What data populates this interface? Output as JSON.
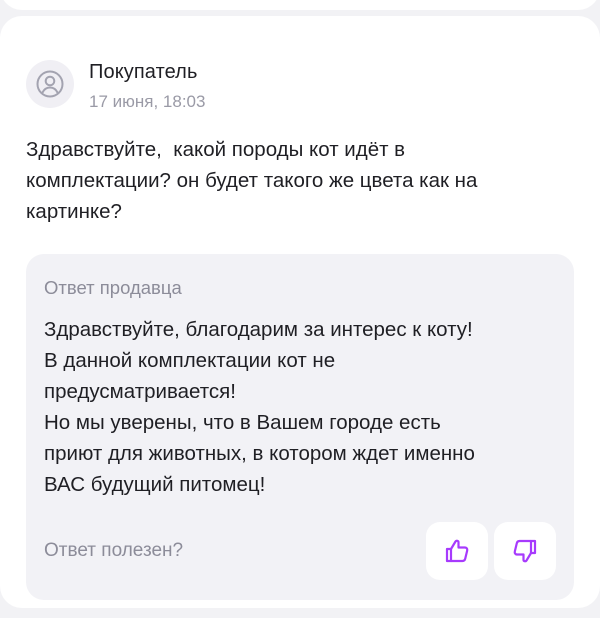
{
  "review": {
    "author": "Покупатель",
    "date": "17 июня, 18:03",
    "avatar_icon": "user-icon",
    "question": "Здравствуйте,  какой породы кот идёт в\nкомплектации? он будет такого же цвета как на\nкартинке?"
  },
  "seller_answer": {
    "title": "Ответ продавца",
    "text": "Здравствуйте, благодарим за интерес к коту!\nВ данной комплектации кот не\nпредусматривается!\nНо мы уверены, что в Вашем городе есть\nприют для животных, в котором ждет именно\nВАС будущий питомец!"
  },
  "feedback": {
    "question": "Ответ полезен?",
    "like_icon": "thumbs-up-icon",
    "dislike_icon": "thumbs-down-icon",
    "accent_color": "#a73afd"
  }
}
